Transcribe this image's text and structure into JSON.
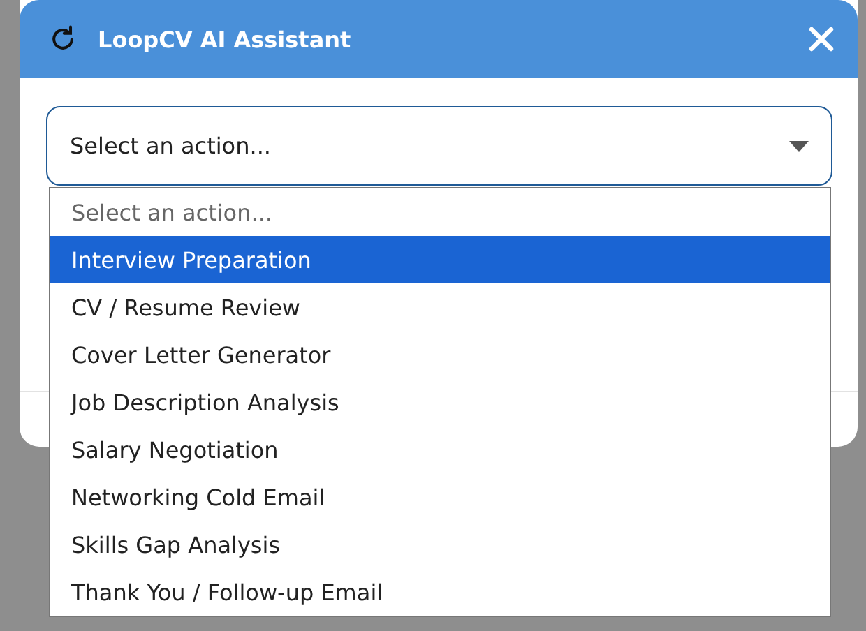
{
  "dialog": {
    "title": "LoopCV AI Assistant"
  },
  "action_select": {
    "placeholder": "Select an action...",
    "expanded": true,
    "options": [
      {
        "label": "Select an action...",
        "kind": "placeholder",
        "selected": false
      },
      {
        "label": "Interview Preparation",
        "kind": "option",
        "selected": true
      },
      {
        "label": "CV / Resume Review",
        "kind": "option",
        "selected": false
      },
      {
        "label": "Cover Letter Generator",
        "kind": "option",
        "selected": false
      },
      {
        "label": "Job Description Analysis",
        "kind": "option",
        "selected": false
      },
      {
        "label": "Salary Negotiation",
        "kind": "option",
        "selected": false
      },
      {
        "label": "Networking Cold Email",
        "kind": "option",
        "selected": false
      },
      {
        "label": "Skills Gap Analysis",
        "kind": "option",
        "selected": false
      },
      {
        "label": "Thank You / Follow-up Email",
        "kind": "option",
        "selected": false
      }
    ]
  }
}
